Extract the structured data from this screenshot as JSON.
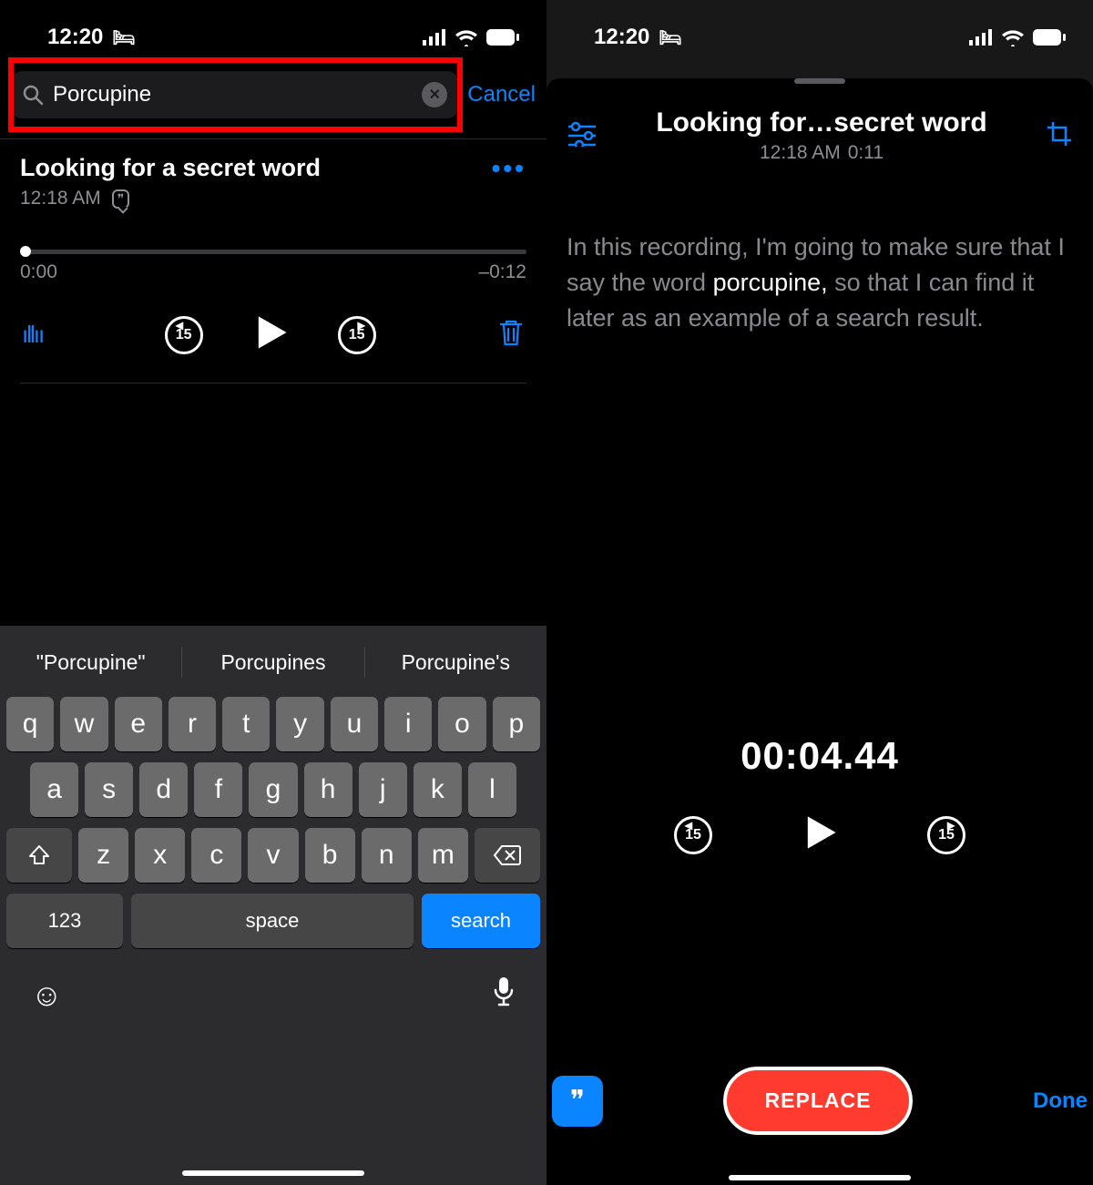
{
  "status": {
    "time": "12:20"
  },
  "left": {
    "search": {
      "value": "Porcupine",
      "cancel": "Cancel"
    },
    "recording": {
      "title": "Looking for a secret word",
      "time": "12:18 AM",
      "pos": "0:00",
      "remain": "–0:12",
      "skip": "15"
    },
    "suggest": [
      "\"Porcupine\"",
      "Porcupines",
      "Porcupine's"
    ],
    "rows": {
      "r1": [
        "q",
        "w",
        "e",
        "r",
        "t",
        "y",
        "u",
        "i",
        "o",
        "p"
      ],
      "r2": [
        "a",
        "s",
        "d",
        "f",
        "g",
        "h",
        "j",
        "k",
        "l"
      ],
      "r3": [
        "z",
        "x",
        "c",
        "v",
        "b",
        "n",
        "m"
      ]
    },
    "num": "123",
    "space": "space",
    "searchKey": "search"
  },
  "right": {
    "title": "Looking for…secret word",
    "subTime": "12:18 AM",
    "subDur": "0:11",
    "transcript": {
      "pre": "In this recording, I'm going to make sure that I say the word ",
      "hl": "porcupine,",
      "post": " so that I can find it later as an example of a search result."
    },
    "playhead": "00:04.44",
    "skip": "15",
    "replace": "REPLACE",
    "done": "Done"
  }
}
